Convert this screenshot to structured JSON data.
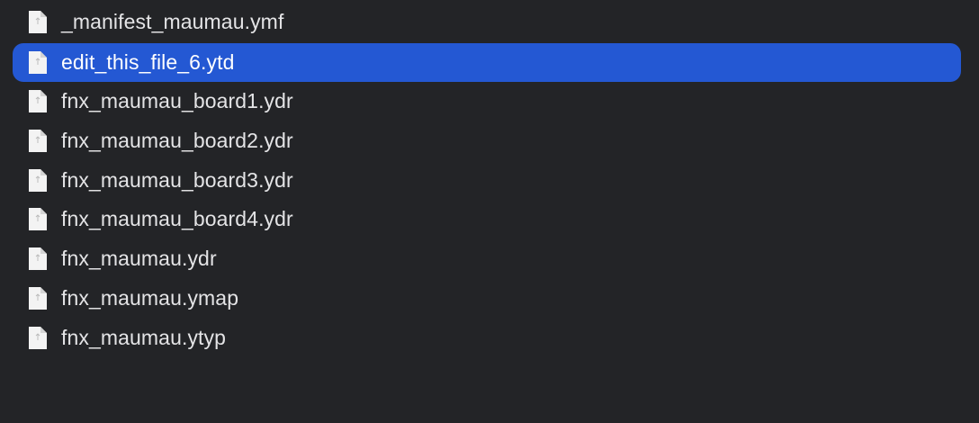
{
  "files": [
    {
      "name": "_manifest_maumau.ymf",
      "icon": "document-icon",
      "selected": false
    },
    {
      "name": "edit_this_file_6.ytd",
      "icon": "document-icon",
      "selected": true
    },
    {
      "name": "fnx_maumau_board1.ydr",
      "icon": "document-icon",
      "selected": false
    },
    {
      "name": "fnx_maumau_board2.ydr",
      "icon": "document-icon",
      "selected": false
    },
    {
      "name": "fnx_maumau_board3.ydr",
      "icon": "document-icon",
      "selected": false
    },
    {
      "name": "fnx_maumau_board4.ydr",
      "icon": "document-icon",
      "selected": false
    },
    {
      "name": "fnx_maumau.ydr",
      "icon": "document-icon",
      "selected": false
    },
    {
      "name": "fnx_maumau.ymap",
      "icon": "document-icon",
      "selected": false
    },
    {
      "name": "fnx_maumau.ytyp",
      "icon": "document-icon",
      "selected": false
    }
  ],
  "colors": {
    "background": "#232427",
    "selection": "#2458d3",
    "text": "#e4e4e6",
    "selected_text": "#ffffff"
  }
}
